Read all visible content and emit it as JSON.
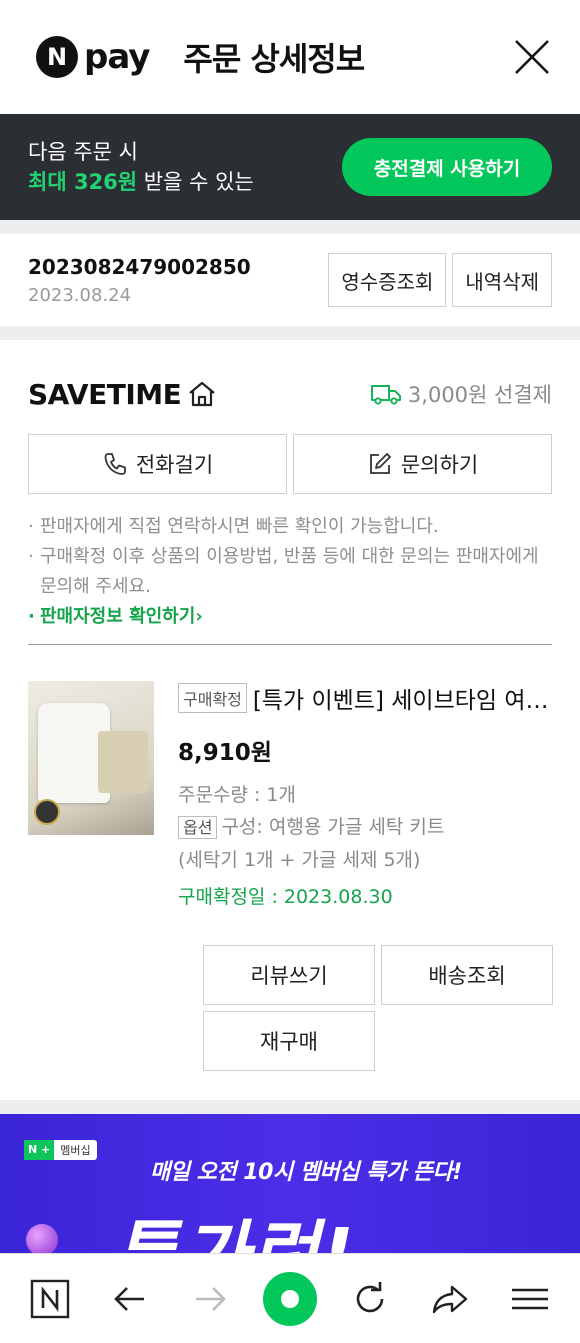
{
  "header": {
    "brand_letter": "N",
    "brand_text": "pay",
    "title": "주문 상세정보"
  },
  "promo": {
    "line1": "다음 주문 시",
    "highlight": "최대 326원",
    "line2_rest": " 받을 수 있는",
    "button": "충전결제 사용하기"
  },
  "order": {
    "number": "2023082479002850",
    "date": "2023.08.24",
    "receipt_button": "영수증조회",
    "delete_button": "내역삭제"
  },
  "store": {
    "name": "SAVETIME",
    "shipping": "3,000원 선결제",
    "call_button": "전화걸기",
    "inquiry_button": "문의하기",
    "notes": [
      "판매자에게 직접 연락하시면 빠른 확인이 가능합니다.",
      "구매확정 이후 상품의 이용방법, 반품 등에 대한 문의는 판매자에게 문의해 주세요."
    ],
    "seller_link": "판매자정보 확인하기"
  },
  "product": {
    "status_tag": "구매확정",
    "name": "[특가 이벤트] 세이브타임 여행용 가글 세탁 키트",
    "price": "8,910원",
    "quantity": "주문수량 : 1개",
    "option_tag": "옵션",
    "option": "구성: 여행용 가글 세탁 키트",
    "option_detail": "(세탁기 1개 + 가글 세제 5개)",
    "confirm_date": "구매확정일 : 2023.08.30",
    "review_button": "리뷰쓰기",
    "delivery_button": "배송조회",
    "rebuy_button": "재구매"
  },
  "ad": {
    "badge_n": "N +",
    "badge_text": "멤버십",
    "subtitle": "매일 오전 10시 멤버십 특가 뜬다!",
    "main": "특가런!"
  },
  "colors": {
    "accent": "#03c75a",
    "dark_banner": "#2b2e33",
    "ad_bg": "#3a25d6"
  },
  "icons": [
    "close-icon",
    "home-icon",
    "truck-icon",
    "phone-icon",
    "edit-icon",
    "n-home-icon",
    "back-icon",
    "forward-icon",
    "reload-icon",
    "share-icon",
    "menu-icon"
  ]
}
